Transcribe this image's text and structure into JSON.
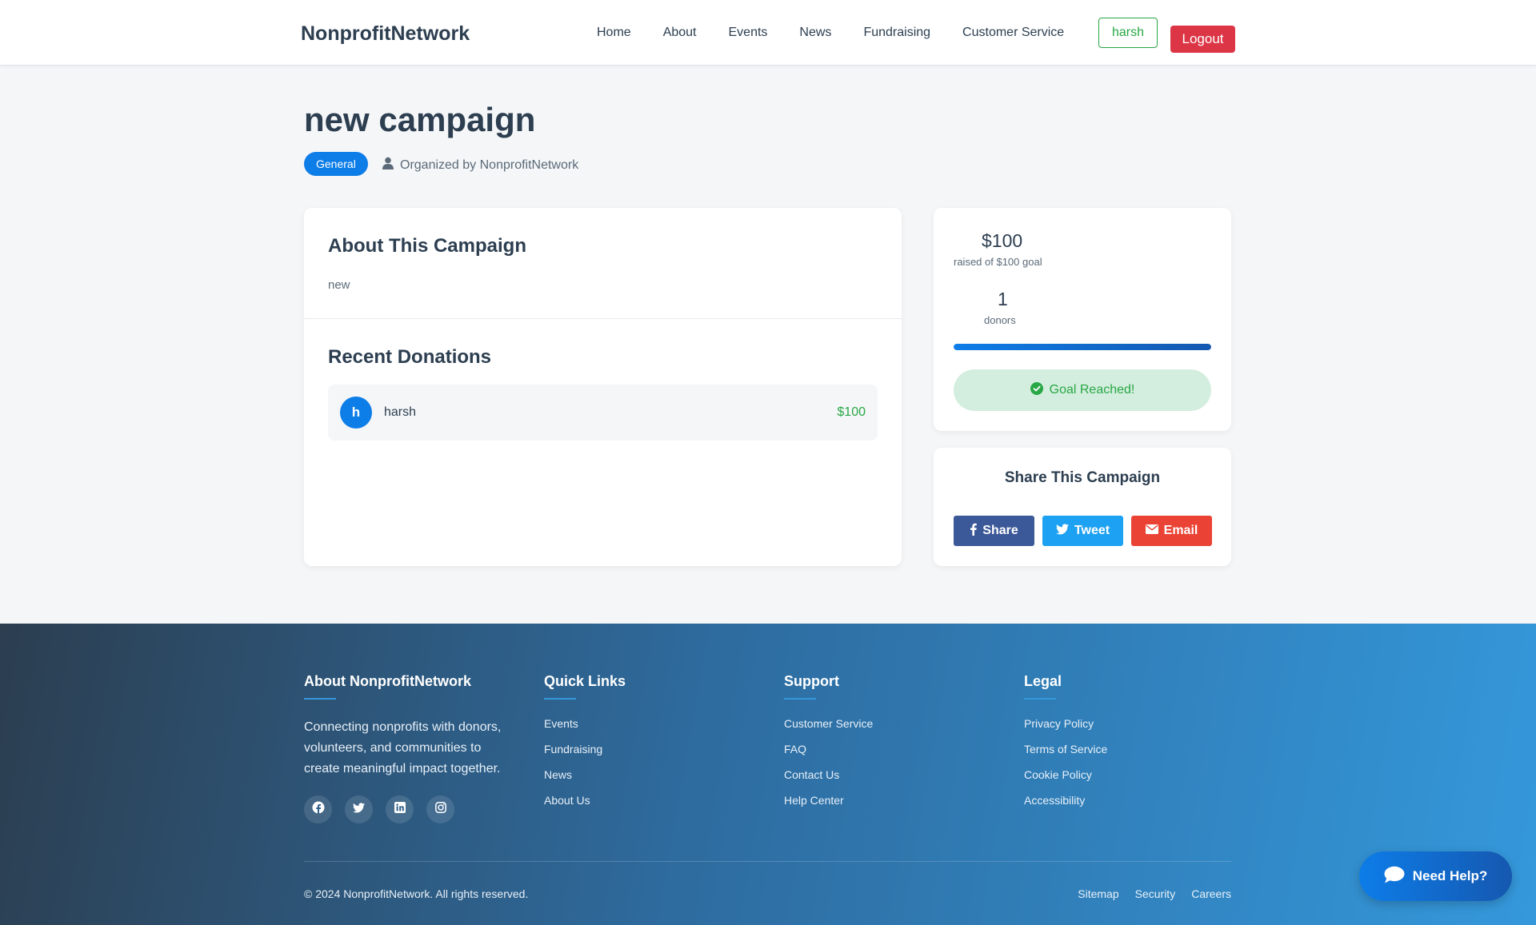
{
  "header": {
    "brand": "NonprofitNetwork",
    "nav": [
      "Home",
      "About",
      "Events",
      "News",
      "Fundraising",
      "Customer Service"
    ],
    "user_label": "harsh",
    "logout_label": "Logout"
  },
  "campaign": {
    "title": "new campaign",
    "category": "General",
    "organizer": "Organized by NonprofitNetwork"
  },
  "about": {
    "title": "About This Campaign",
    "text": "new"
  },
  "donations": {
    "title": "Recent Donations",
    "items": [
      {
        "initial": "h",
        "name": "harsh",
        "amount": "$100"
      }
    ]
  },
  "stats": {
    "raised": "$100",
    "raised_label": "raised of $100 goal",
    "donors": "1",
    "donors_label": "donors",
    "progress_fraction": 1.0,
    "goal_status": "Goal Reached!"
  },
  "share": {
    "title": "Share This Campaign",
    "facebook": "Share",
    "twitter": "Tweet",
    "email": "Email"
  },
  "footer": {
    "about_title": "About NonprofitNetwork",
    "about_text": "Connecting nonprofits with donors, volunteers, and communities to create meaningful impact together.",
    "quick_links_title": "Quick Links",
    "quick_links": [
      "Events",
      "Fundraising",
      "News",
      "About Us"
    ],
    "support_title": "Support",
    "support_links": [
      "Customer Service",
      "FAQ",
      "Contact Us",
      "Help Center"
    ],
    "legal_title": "Legal",
    "legal_links": [
      "Privacy Policy",
      "Terms of Service",
      "Cookie Policy",
      "Accessibility"
    ],
    "copyright": "© 2024 NonprofitNetwork. All rights reserved.",
    "bottom_links": [
      "Sitemap",
      "Security",
      "Careers"
    ]
  },
  "help": {
    "label": "Need Help?"
  },
  "colors": {
    "primary": "#0d7de8",
    "success": "#28a745",
    "danger": "#dc3545",
    "facebook": "#3b5998",
    "twitter": "#1da1f2",
    "email": "#ea4335"
  },
  "icons": {
    "organizer": "user-icon",
    "goal": "check-circle-icon",
    "share_facebook": "facebook-icon",
    "share_twitter": "twitter-icon",
    "share_email": "envelope-icon",
    "socials": [
      "facebook-icon",
      "twitter-icon",
      "linkedin-icon",
      "instagram-icon"
    ],
    "help": "chat-bubble-icon"
  }
}
